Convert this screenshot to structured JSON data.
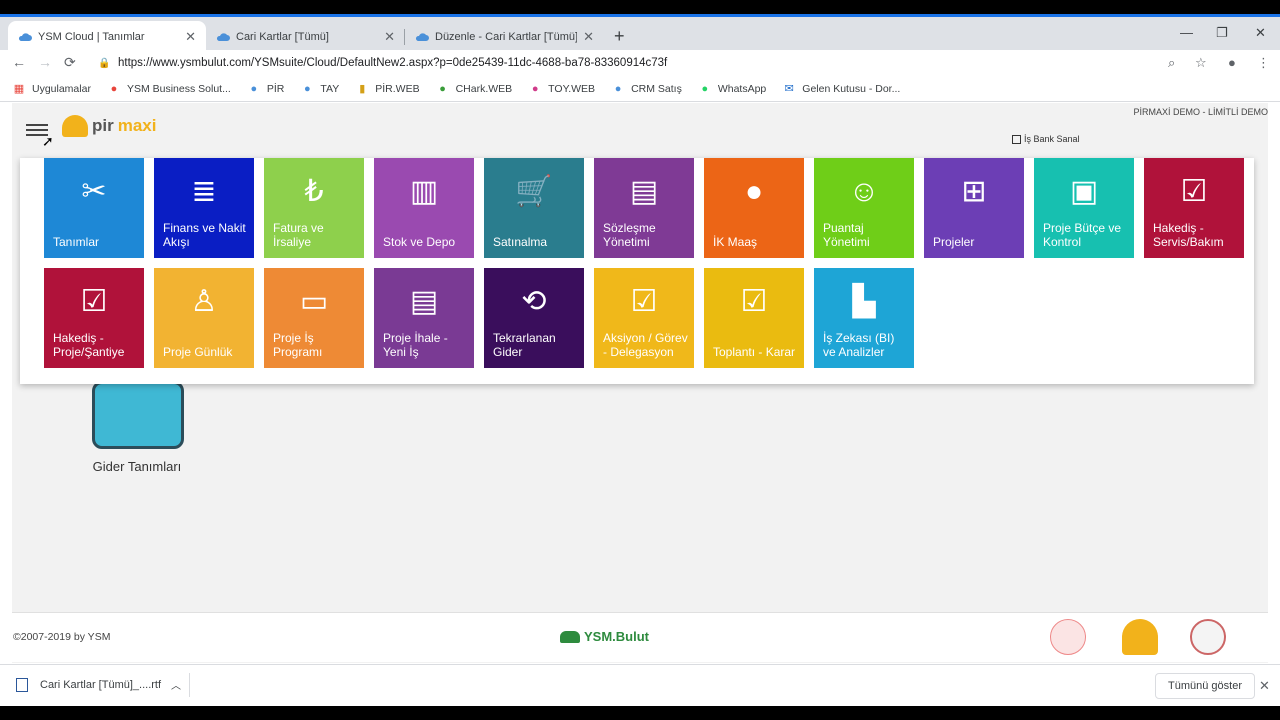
{
  "browser": {
    "tabs": [
      {
        "label": "YSM Cloud | Tanımlar",
        "active": true
      },
      {
        "label": "Cari Kartlar [Tümü]",
        "active": false
      },
      {
        "label": "Düzenle - Cari Kartlar [Tümü]",
        "active": false
      }
    ],
    "new_tab": "+",
    "close_glyph": "✕",
    "url": "https://www.ysmbulut.com/YSMsuite/Cloud/DefaultNew2.aspx?p=0de25439-11dc-4688-ba78-83360914c73f",
    "window_controls": [
      "—",
      "❐",
      "✕"
    ],
    "toolbar_icons": [
      "zoom-icon",
      "star-icon",
      "account-icon",
      "kebab-menu-icon"
    ]
  },
  "bookmarks": [
    {
      "label": "Uygulamalar",
      "icon": "apps-grid-icon",
      "color": "#e8453c"
    },
    {
      "label": "YSM Business Solut...",
      "icon": "ysm-icon",
      "color": "#e8453c"
    },
    {
      "label": "PİR",
      "icon": "cloud-icon",
      "color": "#4a90d9"
    },
    {
      "label": "TAY",
      "icon": "cloud-icon",
      "color": "#4a90d9"
    },
    {
      "label": "PİR.WEB",
      "icon": "lock-icon",
      "color": "#d4a017"
    },
    {
      "label": "CHark.WEB",
      "icon": "leaf-icon",
      "color": "#3a9d3a"
    },
    {
      "label": "TOY.WEB",
      "icon": "toy-icon",
      "color": "#d03c8a"
    },
    {
      "label": "CRM Satış",
      "icon": "cloud-icon",
      "color": "#4a90d9"
    },
    {
      "label": "WhatsApp",
      "icon": "whatsapp-icon",
      "color": "#25d366"
    },
    {
      "label": "Gelen Kutusu - Dor...",
      "icon": "mail-icon",
      "color": "#1b6ac9"
    }
  ],
  "page": {
    "top_right": "PİRMAXİ DEMO - LİMİTLİ DEMO",
    "logo_pir": "pir",
    "logo_maxi": "maxi",
    "bank_chip": "İş Bank Sanal",
    "gider_label": "Gider Tanımları"
  },
  "menu": {
    "tiles": [
      {
        "label": "Tanımlar",
        "color": "#1e88d6",
        "icon": "tools-icon"
      },
      {
        "label": "Finans ve Nakit Akışı",
        "color": "#0a1ec4",
        "icon": "finance-icon"
      },
      {
        "label": "Fatura ve İrsaliye",
        "color": "#8ed04c",
        "icon": "invoice-icon"
      },
      {
        "label": "Stok ve Depo",
        "color": "#9a4ab0",
        "icon": "warehouse-icon"
      },
      {
        "label": "Satınalma",
        "color": "#2a7d8e",
        "icon": "cart-icon"
      },
      {
        "label": "Sözleşme Yönetimi",
        "color": "#7f3a95",
        "icon": "contract-icon"
      },
      {
        "label": "İK Maaş",
        "color": "#ec6516",
        "icon": "person-icon"
      },
      {
        "label": "Puantaj Yönetimi",
        "color": "#6fce18",
        "icon": "team-icon"
      },
      {
        "label": "Projeler",
        "color": "#6c3eb5",
        "icon": "org-chart-icon"
      },
      {
        "label": "Proje Bütçe ve Kontrol",
        "color": "#17c0b0",
        "icon": "presentation-icon"
      },
      {
        "label": "Hakediş - Servis/Bakım",
        "color": "#b0123a",
        "icon": "clipboard-icon"
      },
      {
        "label": "Hakediş - Proje/Şantiye",
        "color": "#b0123a",
        "icon": "clipboard-icon"
      },
      {
        "label": "Proje Günlük",
        "color": "#f2b332",
        "icon": "worker-icon"
      },
      {
        "label": "Proje İş Programı",
        "color": "#ee8a35",
        "icon": "message-icon"
      },
      {
        "label": "Proje İhale - Yeni İş",
        "color": "#7a3a94",
        "icon": "contract-icon"
      },
      {
        "label": "Tekrarlanan Gider",
        "color": "#3a0e5c",
        "icon": "repeat-icon"
      },
      {
        "label": "Aksiyon / Görev - Delegasyon",
        "color": "#f0b81a",
        "icon": "task-icon"
      },
      {
        "label": "Toplantı - Karar",
        "color": "#eabb10",
        "icon": "task-icon"
      },
      {
        "label": "İş Zekası (BI) ve Analizler",
        "color": "#1ea5d6",
        "icon": "bar-chart-icon"
      }
    ]
  },
  "footer": {
    "copyright": "©2007-2019 by YSM",
    "brand": "YSM.Bulut"
  },
  "downloads": {
    "file": "Cari Kartlar [Tümü]_....rtf",
    "show_all": "Tümünü göster"
  }
}
